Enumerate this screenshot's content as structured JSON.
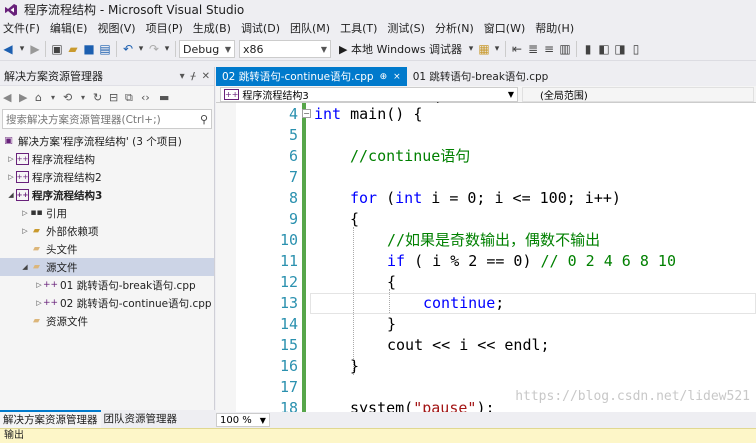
{
  "window": {
    "title": "程序流程结构 - Microsoft Visual Studio"
  },
  "menu": [
    "文件(F)",
    "编辑(E)",
    "视图(V)",
    "项目(P)",
    "生成(B)",
    "调试(D)",
    "团队(M)",
    "工具(T)",
    "测试(S)",
    "分析(N)",
    "窗口(W)",
    "帮助(H)"
  ],
  "toolbar": {
    "config": "Debug",
    "platform": "x86",
    "run_label": "▶ 本地 Windows 调试器"
  },
  "solution_explorer": {
    "title": "解决方案资源管理器",
    "search_placeholder": "搜索解决方案资源管理器(Ctrl+;)",
    "tree": [
      {
        "label": "解决方案'程序流程结构' (3 个项目)",
        "icon": "solution-icon"
      },
      {
        "label": "程序流程结构",
        "icon": "project-icon"
      },
      {
        "label": "程序流程结构2",
        "icon": "project-icon"
      },
      {
        "label": "程序流程结构3",
        "icon": "project-icon"
      },
      {
        "label": "引用",
        "icon": "references-icon"
      },
      {
        "label": "外部依赖项",
        "icon": "external-deps-icon"
      },
      {
        "label": "头文件",
        "icon": "folder-icon"
      },
      {
        "label": "源文件",
        "icon": "folder-icon"
      },
      {
        "label": "01 跳转语句-break语句.cpp",
        "icon": "cpp-file-icon"
      },
      {
        "label": "02 跳转语句-continue语句.cpp",
        "icon": "cpp-file-icon"
      },
      {
        "label": "资源文件",
        "icon": "folder-icon"
      }
    ],
    "bottom_tabs": [
      "解决方案资源管理器",
      "团队资源管理器"
    ]
  },
  "editor": {
    "tabs": [
      {
        "label": "02 跳转语句-continue语句.cpp",
        "pin": "⊕",
        "close": "×"
      },
      {
        "label": "01 跳转语句-break语句.cpp"
      }
    ],
    "nav_project": "程序流程结构3",
    "nav_scope": "(全局范围)",
    "zoom": "100 %",
    "line_numbers": [
      "4",
      "5",
      "6",
      "7",
      "8",
      "9",
      "10",
      "11",
      "12",
      "13",
      "14",
      "15",
      "16",
      "17",
      "18"
    ],
    "code": {
      "l4_kw": "int",
      "l4_rest": " main() {",
      "l6": "//continue语句",
      "l8_kw": "for",
      "l8_a": " (",
      "l8_kw2": "int",
      "l8_rest": " i = 0; i <= 100; i++)",
      "l9": "{",
      "l10": "//如果是奇数输出，偶数不输出",
      "l11_kw": "if",
      "l11_rest": " ( i % 2 == 0) ",
      "l11_cm": "// 0 2 4 6 8 10",
      "l12": "{",
      "l13_kw": "continue",
      "l13_rest": ";",
      "l14": "}",
      "l15": "cout << i << endl;",
      "l16": "}",
      "l18_a": "system(",
      "l18_str": "\"pause\"",
      "l18_b": ");"
    }
  },
  "watermark": "https://blog.csdn.net/lidew521",
  "output_label": "输出",
  "colors": {
    "accent": "#007acc",
    "keyword": "#0000ff",
    "comment": "#008000",
    "string": "#a31515",
    "line_number": "#2b91af"
  }
}
